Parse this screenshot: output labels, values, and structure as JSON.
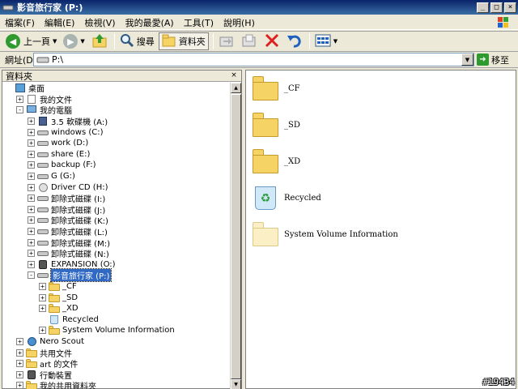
{
  "window": {
    "title": "影音旅行家 (P:)"
  },
  "menu": [
    "檔案(F)",
    "編輯(E)",
    "檢視(V)",
    "我的最愛(A)",
    "工具(T)",
    "說明(H)"
  ],
  "toolbar": {
    "back_label": "上一頁",
    "search_label": "搜尋",
    "folders_label": "資料夾"
  },
  "address": {
    "label": "網址(D)",
    "value": "P:\\",
    "go_label": "移至"
  },
  "folder_pane": {
    "header": "資料夾",
    "tree": [
      {
        "label": "桌面",
        "icon": "desktop-icon",
        "indent": 0,
        "expander": ""
      },
      {
        "label": "我的文件",
        "icon": "documents-icon",
        "indent": 1,
        "expander": "+"
      },
      {
        "label": "我的電腦",
        "icon": "computer-icon",
        "indent": 1,
        "expander": "-"
      },
      {
        "label": "3.5 軟碟機 (A:)",
        "icon": "floppy-icon",
        "indent": 2,
        "expander": "+"
      },
      {
        "label": "windows (C:)",
        "icon": "drive-icon",
        "indent": 2,
        "expander": "+"
      },
      {
        "label": "work (D:)",
        "icon": "drive-icon",
        "indent": 2,
        "expander": "+"
      },
      {
        "label": "share (E:)",
        "icon": "drive-icon",
        "indent": 2,
        "expander": "+"
      },
      {
        "label": "backup (F:)",
        "icon": "drive-icon",
        "indent": 2,
        "expander": "+"
      },
      {
        "label": "G (G:)",
        "icon": "drive-icon",
        "indent": 2,
        "expander": "+"
      },
      {
        "label": "Driver CD (H:)",
        "icon": "cd-icon",
        "indent": 2,
        "expander": "+"
      },
      {
        "label": "卸除式磁碟 (I:)",
        "icon": "drive-icon",
        "indent": 2,
        "expander": "+"
      },
      {
        "label": "卸除式磁碟 (J:)",
        "icon": "drive-icon",
        "indent": 2,
        "expander": "+"
      },
      {
        "label": "卸除式磁碟 (K:)",
        "icon": "drive-icon",
        "indent": 2,
        "expander": "+"
      },
      {
        "label": "卸除式磁碟 (L:)",
        "icon": "drive-icon",
        "indent": 2,
        "expander": "+"
      },
      {
        "label": "卸除式磁碟 (M:)",
        "icon": "drive-icon",
        "indent": 2,
        "expander": "+"
      },
      {
        "label": "卸除式磁碟 (N:)",
        "icon": "drive-icon",
        "indent": 2,
        "expander": "+"
      },
      {
        "label": "EXPANSION (O:)",
        "icon": "device-icon",
        "indent": 2,
        "expander": "+"
      },
      {
        "label": "影音旅行家 (P:)",
        "icon": "drive-icon",
        "indent": 2,
        "expander": "-",
        "selected": true
      },
      {
        "label": "_CF",
        "icon": "folder-icon",
        "indent": 3,
        "expander": "+"
      },
      {
        "label": "_SD",
        "icon": "folder-icon",
        "indent": 3,
        "expander": "+"
      },
      {
        "label": "_XD",
        "icon": "folder-icon",
        "indent": 3,
        "expander": "+"
      },
      {
        "label": "Recycled",
        "icon": "recycle-bin-icon",
        "indent": 3,
        "expander": ""
      },
      {
        "label": "System Volume Information",
        "icon": "folder-icon",
        "indent": 3,
        "expander": "+"
      },
      {
        "label": "Nero Scout",
        "icon": "globe-icon",
        "indent": 1,
        "expander": "+"
      },
      {
        "label": "共用文件",
        "icon": "folder-icon",
        "indent": 1,
        "expander": "+"
      },
      {
        "label": "art 的文件",
        "icon": "folder-icon",
        "indent": 1,
        "expander": "+"
      },
      {
        "label": "行動裝置",
        "icon": "device-icon",
        "indent": 1,
        "expander": "+"
      },
      {
        "label": "我的共用資料夾",
        "icon": "folder-icon",
        "indent": 1,
        "expander": "+"
      }
    ]
  },
  "content": {
    "items": [
      {
        "label": "_CF",
        "icon": "folder-icon"
      },
      {
        "label": "_SD",
        "icon": "folder-icon"
      },
      {
        "label": "_XD",
        "icon": "folder-icon"
      },
      {
        "label": "Recycled",
        "icon": "recycle-bin-icon"
      },
      {
        "label": "System Volume Information",
        "icon": "folder-pale-icon"
      }
    ]
  },
  "watermark": "#19434"
}
